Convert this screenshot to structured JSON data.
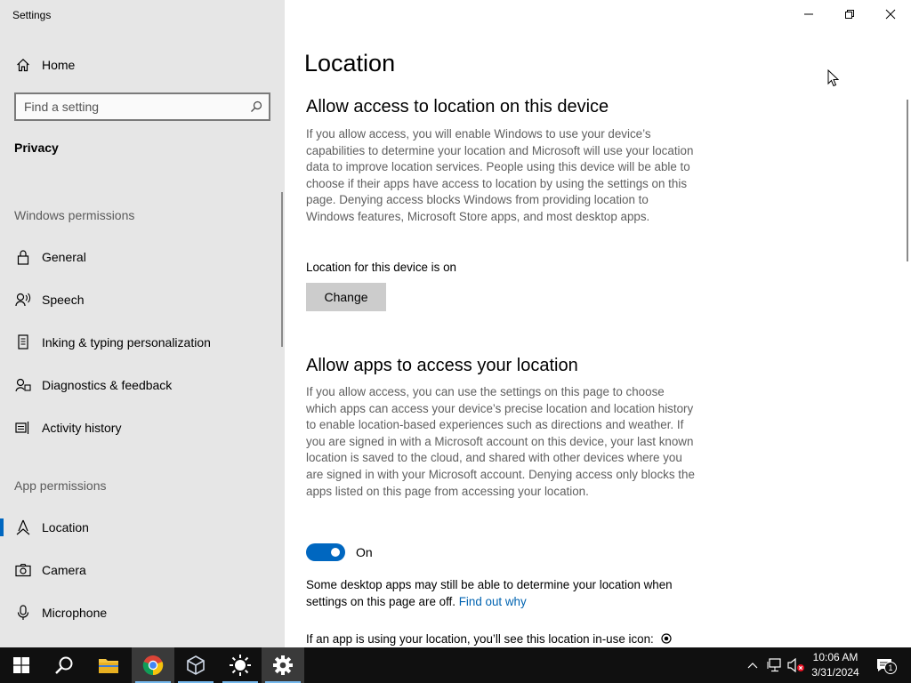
{
  "window": {
    "app_title": "Settings"
  },
  "sidebar": {
    "home_label": "Home",
    "search_placeholder": "Find a setting",
    "category": "Privacy",
    "windows_permissions_header": "Windows permissions",
    "windows_permissions": [
      {
        "label": "General",
        "icon": "lock-icon"
      },
      {
        "label": "Speech",
        "icon": "speech-icon"
      },
      {
        "label": "Inking & typing personalization",
        "icon": "inking-icon"
      },
      {
        "label": "Diagnostics & feedback",
        "icon": "diagnostics-icon"
      },
      {
        "label": "Activity history",
        "icon": "activity-history-icon"
      }
    ],
    "app_permissions_header": "App permissions",
    "app_permissions": [
      {
        "label": "Location",
        "icon": "location-icon",
        "selected": true
      },
      {
        "label": "Camera",
        "icon": "camera-icon"
      },
      {
        "label": "Microphone",
        "icon": "microphone-icon"
      }
    ]
  },
  "main": {
    "title": "Location",
    "section1": {
      "heading": "Allow access to location on this device",
      "body": "If you allow access, you will enable Windows to use your device’s capabilities to determine your location and Microsoft will use your location data to improve location services. People using this device will be able to choose if their apps have access to location by using the settings on this page. Denying access blocks Windows from providing location to Windows features, Microsoft Store apps, and most desktop apps.",
      "status": "Location for this device is on",
      "change_button": "Change"
    },
    "section2": {
      "heading": "Allow apps to access your location",
      "body": "If you allow access, you can use the settings on this page to choose which apps can access your device’s precise location and location history to enable location-based experiences such as directions and weather. If you are signed in with a Microsoft account on this device, your last known location is saved to the cloud, and shared with other devices where you are signed in with your Microsoft account. Denying access only blocks the apps listed on this page from accessing your location.",
      "toggle_state": "On",
      "note_text": "Some desktop apps may still be able to determine your location when settings on this page are off.",
      "note_link": "Find out why",
      "inuse_text": "If an app is using your location, you’ll see this location in-use icon:"
    }
  },
  "taskbar": {
    "apps": [
      "start-icon",
      "search-icon",
      "file-explorer-icon",
      "chrome-icon",
      "virtualbox-icon",
      "brightness-icon",
      "settings-icon"
    ],
    "clock_time": "10:06 AM",
    "clock_date": "3/31/2024",
    "notification_count": "1"
  },
  "colors": {
    "accent": "#0067c0",
    "sidebar_bg": "#e6e6e6",
    "taskbar_bg": "#101010",
    "link": "#0063b1"
  }
}
